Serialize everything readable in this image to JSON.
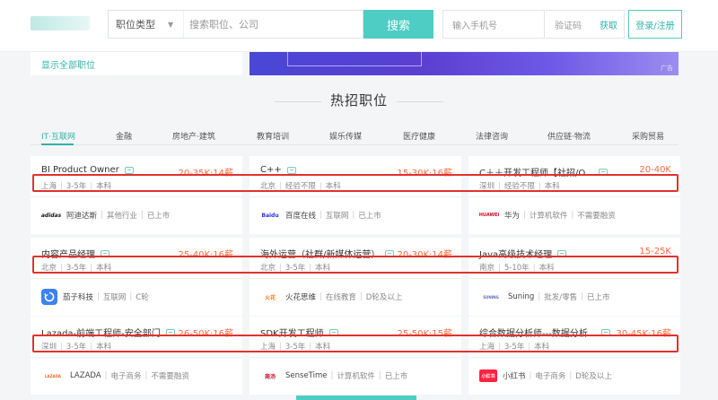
{
  "header": {
    "search_select": "职位类型",
    "search_placeholder": "搜索职位、公司",
    "search_button": "搜索",
    "phone_placeholder": "输入手机号",
    "code_placeholder": "验证码",
    "get_code": "获取",
    "login_button": "登录/注册"
  },
  "top": {
    "show_all": "显示全部职位",
    "banner_ad": "广告"
  },
  "section": {
    "title": "热招职位"
  },
  "tabs": [
    "IT·互联网",
    "金融",
    "房地产·建筑",
    "教育培训",
    "娱乐传媒",
    "医疗健康",
    "法律咨询",
    "供应链·物流",
    "采购贸易"
  ],
  "jobs": [
    {
      "title": "BI Product Owner",
      "salary": "20-35K·14薪",
      "city": "上海",
      "exp": "3-5年",
      "edu": "本科",
      "company": "阿迪达斯",
      "industry": "其他行业",
      "stage": "已上市",
      "logo": "adidas",
      "logo_color": "#111111"
    },
    {
      "title": "C++",
      "salary": "15-30K·16薪",
      "city": "北京",
      "exp": "经验不限",
      "edu": "本科",
      "company": "百度在线",
      "industry": "互联网",
      "stage": "已上市",
      "logo": "Baidu",
      "logo_color": "#2932e1"
    },
    {
      "title": "C＋＋开发工程师【社招/O...",
      "salary": "20-40K",
      "city": "深圳",
      "exp": "经验不限",
      "edu": "本科",
      "company": "华为",
      "industry": "计算机软件",
      "stage": "不需要融资",
      "logo": "HUAWEI",
      "logo_color": "#cf0a2c"
    },
    {
      "title": "内容产品经理",
      "salary": "25-40K·16薪",
      "city": "北京",
      "exp": "3-5年",
      "edu": "本科",
      "company": "茄子科技",
      "industry": "互联网",
      "stage": "C轮",
      "logo": "",
      "logo_color": "#3b82f6"
    },
    {
      "title": "海外运营（社群/新媒体运营）",
      "salary": "20-30K·14薪",
      "city": "北京",
      "exp": "3-5年",
      "edu": "本科",
      "company": "火花思维",
      "industry": "在线教育",
      "stage": "D轮及以上",
      "logo": "火花",
      "logo_color": "#ff7a1a"
    },
    {
      "title": "Java高级技术经理",
      "salary": "15-25K",
      "city": "南京",
      "exp": "5-10年",
      "edu": "本科",
      "company": "Suning",
      "industry": "批发/零售",
      "stage": "已上市",
      "logo": "SUNING",
      "logo_color": "#5b6bbf"
    },
    {
      "title": "Lazada-前端工程师-安全部门",
      "salary": "26-50K·16薪",
      "city": "深圳",
      "exp": "3-5年",
      "edu": "本科",
      "company": "LAZADA",
      "industry": "电子商务",
      "stage": "不需要融资",
      "logo": "LAZADA",
      "logo_color": "#f36f21"
    },
    {
      "title": "SDK开发工程师",
      "salary": "25-50K·15薪",
      "city": "上海",
      "exp": "3-5年",
      "edu": "本科",
      "company": "SenseTime",
      "industry": "计算机软件",
      "stage": "已上市",
      "logo": "商汤",
      "logo_color": "#c8102e"
    },
    {
      "title": "综合数据分析师---数据分析...",
      "salary": "30-45K·16薪",
      "city": "上海",
      "exp": "3-5年",
      "edu": "本科",
      "company": "小红书",
      "industry": "电子商务",
      "stage": "D轮及以上",
      "logo": "小红书",
      "logo_color": "#ff2442"
    }
  ]
}
